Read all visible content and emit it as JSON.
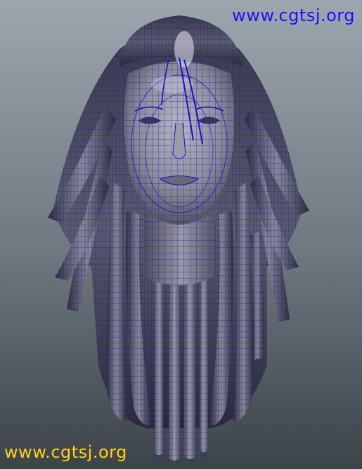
{
  "watermark": {
    "top_text": "www.cgtsj.org",
    "bottom_text": "www.cgtsj.org"
  },
  "colors": {
    "background_top": "#9da6ae",
    "background_bottom": "#3c4349",
    "wireframe": "#1a10c8",
    "mesh_light": "#b9b9c3",
    "mesh_dark": "#2d2d36",
    "watermark_top": "#1a10ff",
    "watermark_bottom": "#ffd21a"
  },
  "viewport": {
    "subject": "head-wireframe-model"
  }
}
